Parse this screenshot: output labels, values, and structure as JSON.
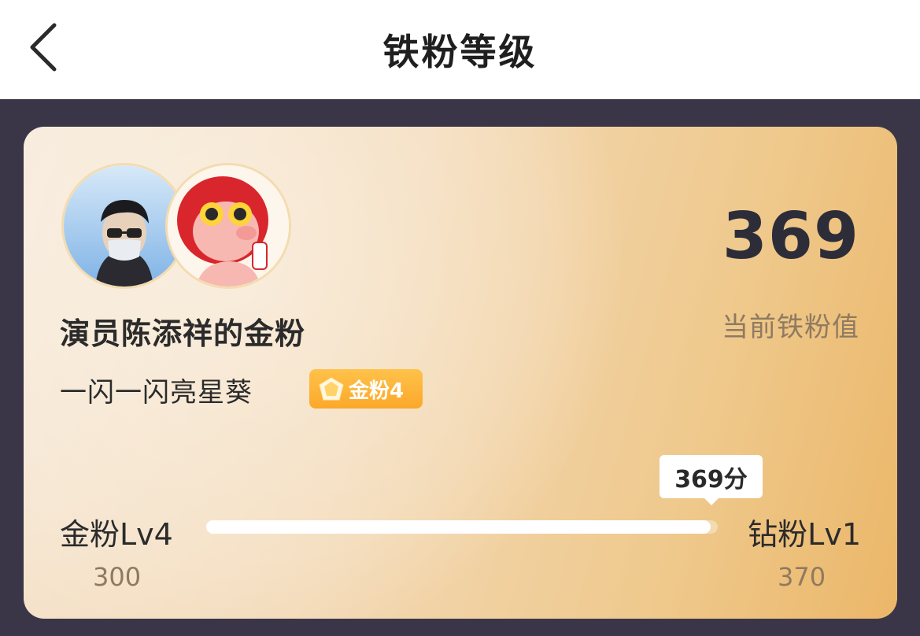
{
  "header": {
    "title": "铁粉等级",
    "back_icon": "chevron-left-icon"
  },
  "card": {
    "fan_title": "演员陈添祥的金粉",
    "nickname": "一闪一闪亮星葵",
    "badge": {
      "icon": "diamond-icon",
      "label": "金粉4",
      "color": "#fbb034"
    },
    "score": "369",
    "score_label": "当前铁粉值",
    "progress": {
      "current_label": "369分",
      "current_value": 369,
      "min": 300,
      "max": 370,
      "min_label": "300",
      "max_label": "370",
      "left_level": "金粉Lv4",
      "right_level": "钻粉Lv1"
    }
  },
  "colors": {
    "dark_background": "#3b3647",
    "card_gradient_start": "#f6e7d4",
    "card_gradient_end": "#ebb769",
    "badge": "#fbb034"
  }
}
